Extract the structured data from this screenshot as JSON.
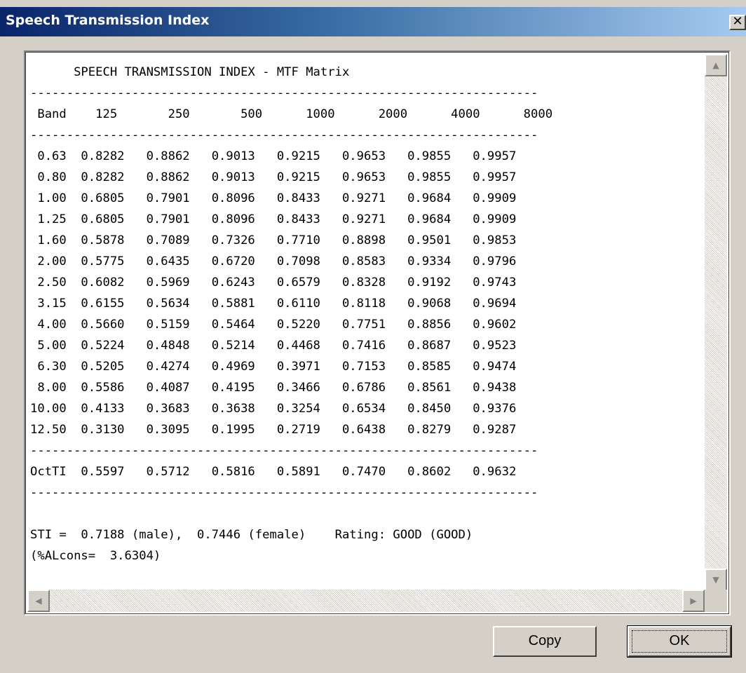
{
  "window": {
    "title": "Speech Transmission Index",
    "close_glyph": "✕"
  },
  "report": {
    "text": "      SPEECH TRANSMISSION INDEX - MTF Matrix\n----------------------------------------------------------------------\n Band    125       250       500      1000      2000      4000      8000\n----------------------------------------------------------------------\n 0.63  0.8282   0.8862   0.9013   0.9215   0.9653   0.9855   0.9957\n 0.80  0.8282   0.8862   0.9013   0.9215   0.9653   0.9855   0.9957\n 1.00  0.6805   0.7901   0.8096   0.8433   0.9271   0.9684   0.9909\n 1.25  0.6805   0.7901   0.8096   0.8433   0.9271   0.9684   0.9909\n 1.60  0.5878   0.7089   0.7326   0.7710   0.8898   0.9501   0.9853\n 2.00  0.5775   0.6435   0.6720   0.7098   0.8583   0.9334   0.9796\n 2.50  0.6082   0.5969   0.6243   0.6579   0.8328   0.9192   0.9743\n 3.15  0.6155   0.5634   0.5881   0.6110   0.8118   0.9068   0.9694\n 4.00  0.5660   0.5159   0.5464   0.5220   0.7751   0.8856   0.9602\n 5.00  0.5224   0.4848   0.5214   0.4468   0.7416   0.8687   0.9523\n 6.30  0.5205   0.4274   0.4969   0.3971   0.7153   0.8585   0.9474\n 8.00  0.5586   0.4087   0.4195   0.3466   0.6786   0.8561   0.9438\n10.00  0.4133   0.3683   0.3638   0.3254   0.6534   0.8450   0.9376\n12.50  0.3130   0.3095   0.1995   0.2719   0.6438   0.8279   0.9287\n----------------------------------------------------------------------\nOctTI  0.5597   0.5712   0.5816   0.5891   0.7470   0.8602   0.9632\n----------------------------------------------------------------------\n\nSTI =  0.7188 (male),  0.7446 (female)    Rating: GOOD (GOOD)\n(%ALcons=  3.6304)"
  },
  "scrollbar": {
    "up_glyph": "▲",
    "down_glyph": "▼",
    "left_glyph": "◀",
    "right_glyph": "▶"
  },
  "buttons": {
    "copy_label": "Copy",
    "ok_label": "OK"
  }
}
